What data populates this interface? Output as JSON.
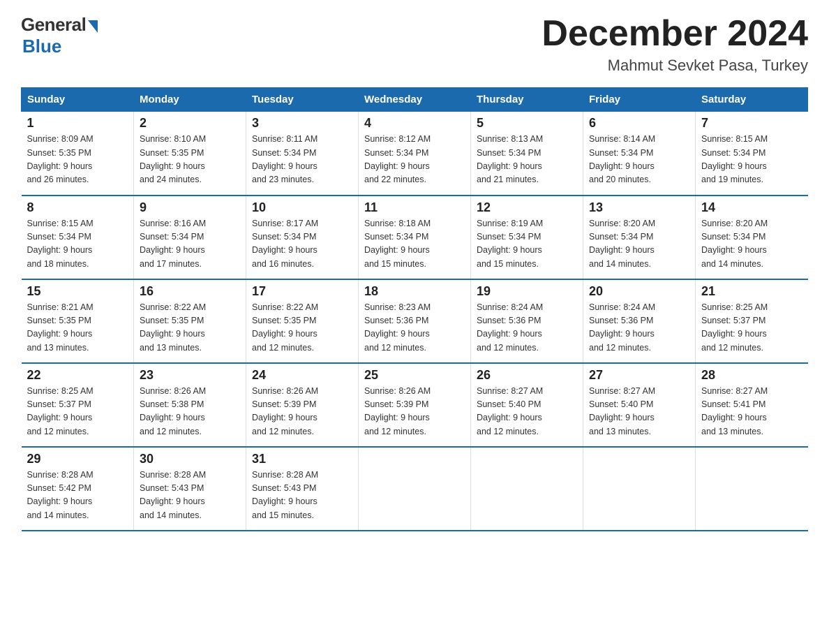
{
  "header": {
    "logo_general": "General",
    "logo_blue": "Blue",
    "month_title": "December 2024",
    "location": "Mahmut Sevket Pasa, Turkey"
  },
  "days_of_week": [
    "Sunday",
    "Monday",
    "Tuesday",
    "Wednesday",
    "Thursday",
    "Friday",
    "Saturday"
  ],
  "weeks": [
    [
      {
        "num": "1",
        "sunrise": "8:09 AM",
        "sunset": "5:35 PM",
        "daylight": "9 hours and 26 minutes."
      },
      {
        "num": "2",
        "sunrise": "8:10 AM",
        "sunset": "5:35 PM",
        "daylight": "9 hours and 24 minutes."
      },
      {
        "num": "3",
        "sunrise": "8:11 AM",
        "sunset": "5:34 PM",
        "daylight": "9 hours and 23 minutes."
      },
      {
        "num": "4",
        "sunrise": "8:12 AM",
        "sunset": "5:34 PM",
        "daylight": "9 hours and 22 minutes."
      },
      {
        "num": "5",
        "sunrise": "8:13 AM",
        "sunset": "5:34 PM",
        "daylight": "9 hours and 21 minutes."
      },
      {
        "num": "6",
        "sunrise": "8:14 AM",
        "sunset": "5:34 PM",
        "daylight": "9 hours and 20 minutes."
      },
      {
        "num": "7",
        "sunrise": "8:15 AM",
        "sunset": "5:34 PM",
        "daylight": "9 hours and 19 minutes."
      }
    ],
    [
      {
        "num": "8",
        "sunrise": "8:15 AM",
        "sunset": "5:34 PM",
        "daylight": "9 hours and 18 minutes."
      },
      {
        "num": "9",
        "sunrise": "8:16 AM",
        "sunset": "5:34 PM",
        "daylight": "9 hours and 17 minutes."
      },
      {
        "num": "10",
        "sunrise": "8:17 AM",
        "sunset": "5:34 PM",
        "daylight": "9 hours and 16 minutes."
      },
      {
        "num": "11",
        "sunrise": "8:18 AM",
        "sunset": "5:34 PM",
        "daylight": "9 hours and 15 minutes."
      },
      {
        "num": "12",
        "sunrise": "8:19 AM",
        "sunset": "5:34 PM",
        "daylight": "9 hours and 15 minutes."
      },
      {
        "num": "13",
        "sunrise": "8:20 AM",
        "sunset": "5:34 PM",
        "daylight": "9 hours and 14 minutes."
      },
      {
        "num": "14",
        "sunrise": "8:20 AM",
        "sunset": "5:34 PM",
        "daylight": "9 hours and 14 minutes."
      }
    ],
    [
      {
        "num": "15",
        "sunrise": "8:21 AM",
        "sunset": "5:35 PM",
        "daylight": "9 hours and 13 minutes."
      },
      {
        "num": "16",
        "sunrise": "8:22 AM",
        "sunset": "5:35 PM",
        "daylight": "9 hours and 13 minutes."
      },
      {
        "num": "17",
        "sunrise": "8:22 AM",
        "sunset": "5:35 PM",
        "daylight": "9 hours and 12 minutes."
      },
      {
        "num": "18",
        "sunrise": "8:23 AM",
        "sunset": "5:36 PM",
        "daylight": "9 hours and 12 minutes."
      },
      {
        "num": "19",
        "sunrise": "8:24 AM",
        "sunset": "5:36 PM",
        "daylight": "9 hours and 12 minutes."
      },
      {
        "num": "20",
        "sunrise": "8:24 AM",
        "sunset": "5:36 PM",
        "daylight": "9 hours and 12 minutes."
      },
      {
        "num": "21",
        "sunrise": "8:25 AM",
        "sunset": "5:37 PM",
        "daylight": "9 hours and 12 minutes."
      }
    ],
    [
      {
        "num": "22",
        "sunrise": "8:25 AM",
        "sunset": "5:37 PM",
        "daylight": "9 hours and 12 minutes."
      },
      {
        "num": "23",
        "sunrise": "8:26 AM",
        "sunset": "5:38 PM",
        "daylight": "9 hours and 12 minutes."
      },
      {
        "num": "24",
        "sunrise": "8:26 AM",
        "sunset": "5:39 PM",
        "daylight": "9 hours and 12 minutes."
      },
      {
        "num": "25",
        "sunrise": "8:26 AM",
        "sunset": "5:39 PM",
        "daylight": "9 hours and 12 minutes."
      },
      {
        "num": "26",
        "sunrise": "8:27 AM",
        "sunset": "5:40 PM",
        "daylight": "9 hours and 12 minutes."
      },
      {
        "num": "27",
        "sunrise": "8:27 AM",
        "sunset": "5:40 PM",
        "daylight": "9 hours and 13 minutes."
      },
      {
        "num": "28",
        "sunrise": "8:27 AM",
        "sunset": "5:41 PM",
        "daylight": "9 hours and 13 minutes."
      }
    ],
    [
      {
        "num": "29",
        "sunrise": "8:28 AM",
        "sunset": "5:42 PM",
        "daylight": "9 hours and 14 minutes."
      },
      {
        "num": "30",
        "sunrise": "8:28 AM",
        "sunset": "5:43 PM",
        "daylight": "9 hours and 14 minutes."
      },
      {
        "num": "31",
        "sunrise": "8:28 AM",
        "sunset": "5:43 PM",
        "daylight": "9 hours and 15 minutes."
      },
      null,
      null,
      null,
      null
    ]
  ],
  "labels": {
    "sunrise": "Sunrise:",
    "sunset": "Sunset:",
    "daylight": "Daylight:"
  }
}
